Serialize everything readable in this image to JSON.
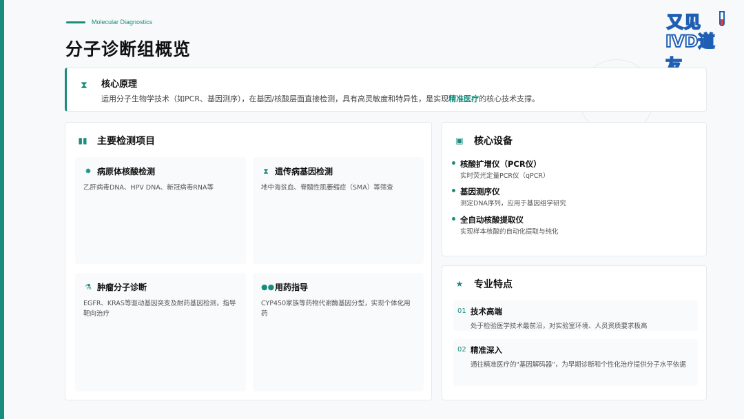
{
  "header": {
    "eyebrow": "Molecular Diagnostics",
    "title": "分子诊断组概览"
  },
  "logo": {
    "line1": "又见",
    "line2": "IVD道友"
  },
  "principle": {
    "icon": "dna-icon",
    "title": "核心原理",
    "text_before": "运用分子生物学技术（如PCR、基因测序），在基因/核酸层面直接检测，具有高灵敏度和特异性，是实现",
    "highlight": "精准医疗",
    "text_after": "的核心技术支撑。"
  },
  "projects": {
    "icon": "test-tubes-icon",
    "title": "主要检测项目",
    "items": [
      {
        "icon": "virus-icon",
        "title": "病原体核酸检测",
        "desc": "乙肝病毒DNA、HPV DNA、新冠病毒RNA等"
      },
      {
        "icon": "dna-icon",
        "title": "遗传病基因检测",
        "desc": "地中海贫血、脊髓性肌萎缩症（SMA）等筛查"
      },
      {
        "icon": "microscope-icon",
        "title": "肿瘤分子诊断",
        "desc": "EGFR、KRAS等驱动基因突变及耐药基因检测，指导靶向治疗"
      },
      {
        "icon": "pills-icon",
        "title": "用药指导",
        "desc": "CYP450家族等药物代谢酶基因分型，实现个体化用药"
      }
    ]
  },
  "equipment": {
    "icon": "chip-icon",
    "title": "核心设备",
    "items": [
      {
        "name": "核酸扩增仪（PCR仪）",
        "desc": "实时荧光定量PCR仪（qPCR）"
      },
      {
        "name": "基因测序仪",
        "desc": "测定DNA序列，应用于基因组学研究"
      },
      {
        "name": "全自动核酸提取仪",
        "desc": "实现样本核酸的自动化提取与纯化"
      }
    ]
  },
  "features": {
    "icon": "star-icon",
    "title": "专业特点",
    "items": [
      {
        "num": "01",
        "title": "技术高端",
        "desc": "处于检验医学技术最前沿，对实验室环境、人员资质要求极高"
      },
      {
        "num": "02",
        "title": "精准深入",
        "desc": "通往精准医疗的\"基因解码器\"，为早期诊断和个性化治疗提供分子水平依据"
      }
    ]
  },
  "colors": {
    "accent": "#1a8c7d",
    "logo_blue": "#1e5fb4"
  }
}
